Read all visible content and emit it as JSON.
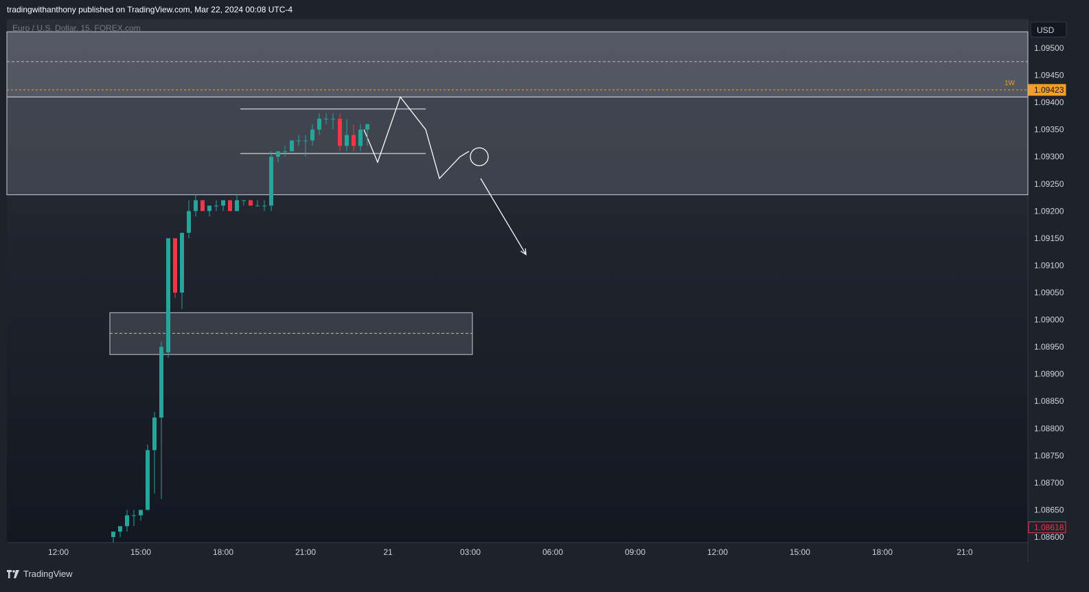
{
  "header": {
    "publisher": "tradingwithanthony published on TradingView.com, Mar 22, 2024 00:08 UTC-4"
  },
  "footer": {
    "brand": "TradingView"
  },
  "colors": {
    "up": "#26a69a",
    "down": "#f23645",
    "background_top": "#2a2e39",
    "background_bottom": "#131722",
    "accent_orange": "#f59d2a",
    "current_price": "#f23645"
  },
  "chart_data": {
    "type": "candlestick",
    "title": "Euro / U.S. Dollar, 15, FOREX.com",
    "currency_label": "USD",
    "ylim": [
      1.0859,
      1.0953
    ],
    "y_ticks": [
      1.095,
      1.0945,
      1.094,
      1.0935,
      1.093,
      1.0925,
      1.092,
      1.0915,
      1.091,
      1.0905,
      1.09,
      1.0895,
      1.089,
      1.0885,
      1.088,
      1.0875,
      1.087,
      1.0865,
      1.086
    ],
    "y_tick_labels": [
      "1.09500",
      "1.09450",
      "1.09400",
      "1.09350",
      "1.09300",
      "1.09250",
      "1.09200",
      "1.09150",
      "1.09100",
      "1.09050",
      "1.09000",
      "1.08950",
      "1.08900",
      "1.08850",
      "1.08800",
      "1.08750",
      "1.08700",
      "1.08650",
      "1.08600"
    ],
    "x_labels": [
      {
        "label": "12:00",
        "bar": -8
      },
      {
        "label": "15:00",
        "bar": 4
      },
      {
        "label": "18:00",
        "bar": 16
      },
      {
        "label": "21:00",
        "bar": 28
      },
      {
        "label": "21",
        "bar": 40
      },
      {
        "label": "03:00",
        "bar": 52
      },
      {
        "label": "06:00",
        "bar": 64
      },
      {
        "label": "09:00",
        "bar": 76
      },
      {
        "label": "12:00",
        "bar": 88
      },
      {
        "label": "15:00",
        "bar": 100
      },
      {
        "label": "18:00",
        "bar": 112
      },
      {
        "label": "21:0",
        "bar": 124
      }
    ],
    "price_labels": [
      {
        "label": "1.09423",
        "value": 1.09423,
        "role": "level",
        "tag": "1W"
      },
      {
        "label": "1.08618",
        "value": 1.08618,
        "role": "current"
      }
    ],
    "zones": [
      {
        "from_bar": -13,
        "to_bar": -13,
        "y1": 1.0941,
        "y2": 1.0953,
        "full_width": true,
        "mid": 1.09475
      },
      {
        "from_bar": -13,
        "to_bar": -13,
        "y1": 1.0923,
        "y2": 1.0941,
        "full_width": true
      },
      {
        "from_bar": 0,
        "to_bar": 52,
        "y1": 1.08936,
        "y2": 1.09013,
        "mid": 1.08975
      }
    ],
    "range_box": {
      "from_bar": 19,
      "to_bar": 46,
      "top": 1.09388,
      "bottom": 1.09306
    },
    "drawing_path": [
      {
        "bar": 37,
        "value": 1.0935
      },
      {
        "bar": 39,
        "value": 1.0929
      },
      {
        "bar": 42.3,
        "value": 1.0941
      },
      {
        "bar": 46,
        "value": 1.0935
      },
      {
        "bar": 48,
        "value": 1.0926
      },
      {
        "bar": 51,
        "value": 1.093
      },
      {
        "bar": 52.3,
        "value": 1.0931
      }
    ],
    "arrow": {
      "from_bar": 54,
      "from_value": 1.0926,
      "to_bar": 60,
      "to_value": 1.0912
    },
    "circle": {
      "bar": 53.8,
      "value": 1.093
    },
    "bars_start_x": 160,
    "bar_spacing": 10,
    "candles": [
      {
        "o": 1.086,
        "h": 1.0861,
        "l": 1.0859,
        "c": 1.0861
      },
      {
        "o": 1.0861,
        "h": 1.0862,
        "l": 1.086,
        "c": 1.0862
      },
      {
        "o": 1.0862,
        "h": 1.0865,
        "l": 1.0861,
        "c": 1.0864
      },
      {
        "o": 1.0864,
        "h": 1.0865,
        "l": 1.0862,
        "c": 1.0864
      },
      {
        "o": 1.0864,
        "h": 1.0865,
        "l": 1.0863,
        "c": 1.0865
      },
      {
        "o": 1.0865,
        "h": 1.0877,
        "l": 1.0865,
        "c": 1.0876
      },
      {
        "o": 1.0876,
        "h": 1.0883,
        "l": 1.0868,
        "c": 1.0882
      },
      {
        "o": 1.0882,
        "h": 1.0896,
        "l": 1.0867,
        "c": 1.0895
      },
      {
        "o": 1.0894,
        "h": 1.0908,
        "l": 1.0893,
        "c": 1.0915
      },
      {
        "o": 1.0915,
        "h": 1.0915,
        "l": 1.0904,
        "c": 1.0905
      },
      {
        "o": 1.0905,
        "h": 1.0913,
        "l": 1.0902,
        "c": 1.0916
      },
      {
        "o": 1.0916,
        "h": 1.0922,
        "l": 1.0915,
        "c": 1.092
      },
      {
        "o": 1.092,
        "h": 1.0923,
        "l": 1.0919,
        "c": 1.0922
      },
      {
        "o": 1.0922,
        "h": 1.0922,
        "l": 1.092,
        "c": 1.092
      },
      {
        "o": 1.092,
        "h": 1.0921,
        "l": 1.0919,
        "c": 1.0921
      },
      {
        "o": 1.0921,
        "h": 1.0922,
        "l": 1.092,
        "c": 1.0921
      },
      {
        "o": 1.0921,
        "h": 1.0922,
        "l": 1.092,
        "c": 1.0922
      },
      {
        "o": 1.0922,
        "h": 1.0922,
        "l": 1.092,
        "c": 1.092
      },
      {
        "o": 1.092,
        "h": 1.0923,
        "l": 1.092,
        "c": 1.0922
      },
      {
        "o": 1.0922,
        "h": 1.0922,
        "l": 1.0921,
        "c": 1.0922
      },
      {
        "o": 1.0922,
        "h": 1.0922,
        "l": 1.0921,
        "c": 1.0921
      },
      {
        "o": 1.0921,
        "h": 1.0922,
        "l": 1.0921,
        "c": 1.0921
      },
      {
        "o": 1.0921,
        "h": 1.0922,
        "l": 1.092,
        "c": 1.0921
      },
      {
        "o": 1.0921,
        "h": 1.0931,
        "l": 1.092,
        "c": 1.093
      },
      {
        "o": 1.093,
        "h": 1.0931,
        "l": 1.0929,
        "c": 1.0931
      },
      {
        "o": 1.0931,
        "h": 1.0932,
        "l": 1.093,
        "c": 1.0931
      },
      {
        "o": 1.0931,
        "h": 1.0933,
        "l": 1.0931,
        "c": 1.0933
      },
      {
        "o": 1.0933,
        "h": 1.0934,
        "l": 1.0932,
        "c": 1.0933
      },
      {
        "o": 1.0933,
        "h": 1.0934,
        "l": 1.093,
        "c": 1.0933
      },
      {
        "o": 1.0933,
        "h": 1.0936,
        "l": 1.0932,
        "c": 1.0935
      },
      {
        "o": 1.0935,
        "h": 1.0938,
        "l": 1.0934,
        "c": 1.0937
      },
      {
        "o": 1.0937,
        "h": 1.0938,
        "l": 1.0936,
        "c": 1.0937
      },
      {
        "o": 1.0937,
        "h": 1.0938,
        "l": 1.0935,
        "c": 1.0937
      },
      {
        "o": 1.0937,
        "h": 1.0938,
        "l": 1.0931,
        "c": 1.0932
      },
      {
        "o": 1.0932,
        "h": 1.0937,
        "l": 1.0931,
        "c": 1.0934
      },
      {
        "o": 1.0934,
        "h": 1.0936,
        "l": 1.0931,
        "c": 1.0932
      },
      {
        "o": 1.0932,
        "h": 1.0936,
        "l": 1.0931,
        "c": 1.0935
      },
      {
        "o": 1.0935,
        "h": 1.0936,
        "l": 1.0932,
        "c": 1.0936
      }
    ]
  }
}
